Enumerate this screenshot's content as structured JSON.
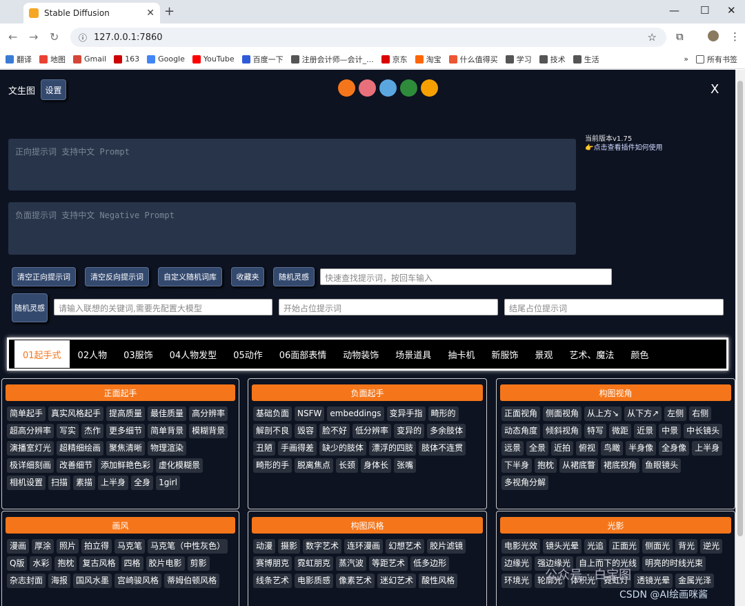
{
  "browser": {
    "tab_title": "Stable Diffusion",
    "url": "127.0.0.1:7860",
    "bookmarks": [
      "翻译",
      "地图",
      "Gmail",
      "163",
      "Google",
      "YouTube",
      "百度一下",
      "注册会计师—会计_...",
      "京东",
      "淘宝",
      "什么值得买",
      "学习",
      "技术",
      "生活"
    ],
    "all_bookmarks": "所有书签"
  },
  "header": {
    "title": "文生图",
    "settings": "设置",
    "close": "X"
  },
  "colors": [
    "#f5761a",
    "#e8707a",
    "#5aa7e0",
    "#2e8b3a",
    "#f5a000"
  ],
  "prompt": {
    "placeholder": "正向提示词 支持中文 Prompt"
  },
  "negative": {
    "placeholder": "负面提示词 支持中文 Negative Prompt"
  },
  "version": {
    "text": "当前版本v1.75",
    "link": "点击查看插件如何使用"
  },
  "toolbar": {
    "clear_pos": "清空正向提示词",
    "clear_neg": "清空反向提示词",
    "custom_random": "自定义随机词库",
    "favorites": "收藏夹",
    "random_inspire": "随机灵感",
    "quick_search": "快速查找提示词，按回车输入",
    "random2": "随机灵感",
    "keyword": "请输入联想的关键词,需要先配置大模型",
    "start_placeholder": "开始占位提示词",
    "end_placeholder": "结尾占位提示词"
  },
  "categories": [
    "01起手式",
    "02人物",
    "03服饰",
    "04人物发型",
    "05动作",
    "06面部表情",
    "动物装饰",
    "场景道具",
    "抽卡机",
    "新服饰",
    "景观",
    "艺术、魔法",
    "颜色"
  ],
  "panels": [
    {
      "title": "正面起手",
      "items": [
        "简单起手",
        "真实风格起手",
        "提高质量",
        "最佳质量",
        "高分辨率",
        "超高分辨率",
        "写实",
        "杰作",
        "更多细节",
        "简单背景",
        "模糊背景",
        "演播室灯光",
        "超精细绘画",
        "聚焦清晰",
        "物理渲染",
        "极详细刻画",
        "改善细节",
        "添加鲜艳色彩",
        "虚化模糊景",
        "相机设置",
        "扫描",
        "素描",
        "上半身",
        "全身",
        "1girl"
      ]
    },
    {
      "title": "负面起手",
      "items": [
        "基础负面",
        "NSFW",
        "embeddings",
        "变异手指",
        "畸形的",
        "解剖不良",
        "毁容",
        "脸不好",
        "低分辨率",
        "变异的",
        "多余肢体",
        "丑陋",
        "手画得差",
        "缺少的肢体",
        "漂浮的四肢",
        "肢体不连贯",
        "畸形的手",
        "脱离焦点",
        "长颈",
        "身体长",
        "张嘴"
      ]
    },
    {
      "title": "构图视角",
      "items": [
        "正面视角",
        "侧面视角",
        "从上方↘",
        "从下方↗",
        "左侧",
        "右侧",
        "动态角度",
        "倾斜视角",
        "特写",
        "微距",
        "近景",
        "中景",
        "中长镜头",
        "远景",
        "全景",
        "近拍",
        "俯视",
        "鸟瞰",
        "半身像",
        "全身像",
        "上半身",
        "下半身",
        "抱枕",
        "从裙底瞥",
        "裙底视角",
        "鱼眼镜头",
        "多视角分解"
      ]
    },
    {
      "title": "画风",
      "items": [
        "漫画",
        "厚涂",
        "照片",
        "拍立得",
        "马克笔",
        "马克笔（中性灰色）",
        "Q版",
        "水彩",
        "抱枕",
        "复古风格",
        "四格",
        "胶片电影",
        "剪影",
        "杂志封面",
        "海报",
        "国风水墨",
        "宫崎骏风格",
        "蒂姆伯顿风格"
      ]
    },
    {
      "title": "构图风格",
      "items": [
        "动漫",
        "摄影",
        "数字艺术",
        "连环漫画",
        "幻想艺术",
        "胶片滤镜",
        "赛博朋克",
        "霓虹朋克",
        "蒸汽波",
        "等距艺术",
        "低多边形",
        "线条艺术",
        "电影质感",
        "像素艺术",
        "迷幻艺术",
        "酸性风格"
      ]
    },
    {
      "title": "光影",
      "items": [
        "电影光效",
        "镜头光晕",
        "光追",
        "正面光",
        "侧面光",
        "背光",
        "逆光",
        "边缘光",
        "强边缘光",
        "自上而下的光线",
        "明亮的时线光束",
        "环境光",
        "轮廓光",
        "体积光",
        "霓虹灯",
        "透镜光晕",
        "金属光泽"
      ]
    }
  ],
  "watermark": {
    "line1": "公众号 · 白宝图",
    "line2": "CSDN @AI绘画咪酱"
  }
}
